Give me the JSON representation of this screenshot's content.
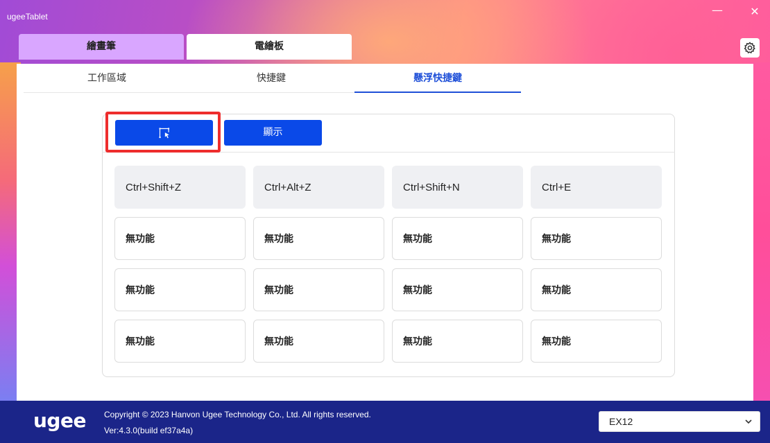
{
  "app": {
    "title": "ugeeTablet"
  },
  "window": {
    "minimize": "—",
    "close": "✕"
  },
  "top_tabs": [
    {
      "label": "繪畫筆"
    },
    {
      "label": "電繪板"
    }
  ],
  "sub_tabs": [
    {
      "label": "工作區域"
    },
    {
      "label": "快捷鍵"
    },
    {
      "label": "懸浮快捷鍵",
      "active": true
    }
  ],
  "mode_buttons": {
    "icon_label": "",
    "show_label": "顯示"
  },
  "shortcuts": [
    [
      "Ctrl+Shift+Z",
      "Ctrl+Alt+Z",
      "Ctrl+Shift+N",
      "Ctrl+E"
    ],
    [
      "無功能",
      "無功能",
      "無功能",
      "無功能"
    ],
    [
      "無功能",
      "無功能",
      "無功能",
      "無功能"
    ],
    [
      "無功能",
      "無功能",
      "無功能",
      "無功能"
    ]
  ],
  "footer": {
    "logo": "ugee",
    "copyright": "Copyright © 2023 Hanvon Ugee Technology Co., Ltd. All rights reserved.",
    "version": "Ver:4.3.0(build ef37a4a)",
    "device": "EX12"
  },
  "colors": {
    "accent": "#0a49e8",
    "highlight": "#ee2d2d",
    "footer": "#1b2589",
    "pen_tab": "#d9a6ff"
  }
}
